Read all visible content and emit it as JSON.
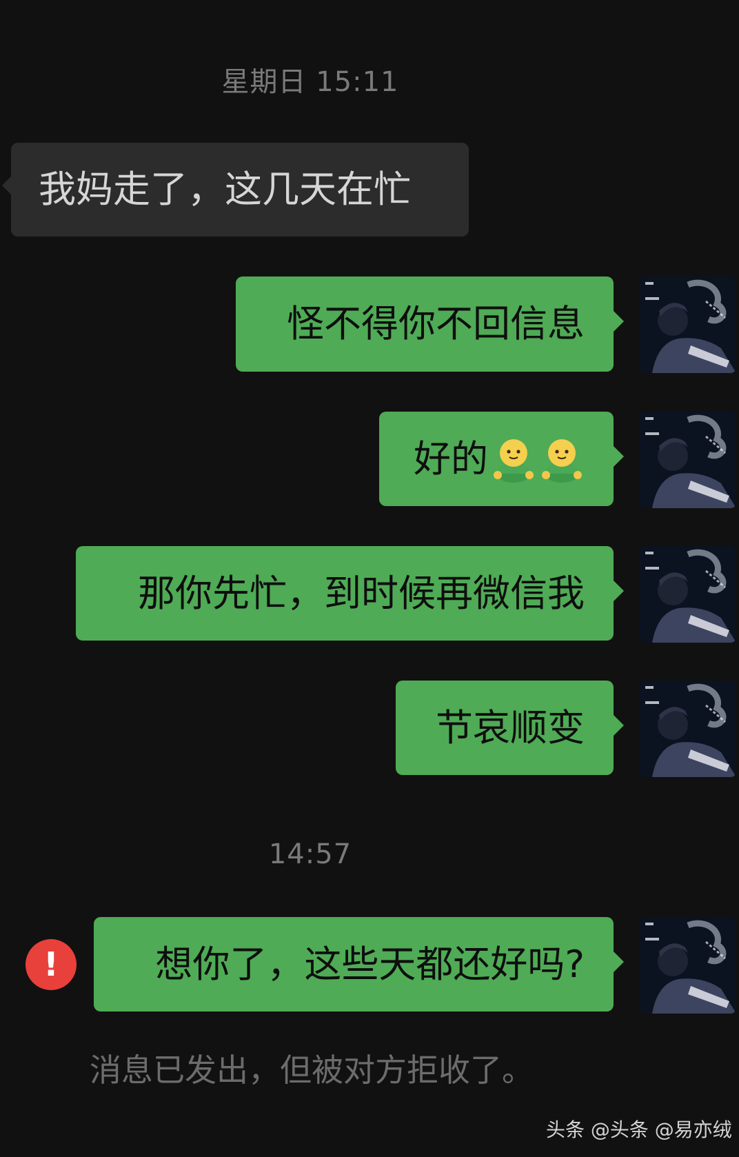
{
  "chat": {
    "timestamp_1": "星期日 15:11",
    "timestamp_2": "14:57",
    "messages": [
      {
        "direction": "incoming",
        "text": "我妈走了，这几天在忙"
      },
      {
        "direction": "outgoing",
        "text": "怪不得你不回信息"
      },
      {
        "direction": "outgoing",
        "text": "好的",
        "emojis": [
          "smiling-figure-emoji",
          "smiling-figure-emoji"
        ]
      },
      {
        "direction": "outgoing",
        "text": "那你先忙，到时候再微信我"
      },
      {
        "direction": "outgoing",
        "text": "节哀顺变"
      },
      {
        "direction": "outgoing",
        "text": "想你了，这些天都还好吗?",
        "status": "failed"
      }
    ],
    "error_icon_symbol": "!",
    "system_note": "消息已发出，但被对方拒收了。"
  },
  "watermark": "头条 @头条 @易亦绒",
  "colors": {
    "background": "#111111",
    "incoming_bubble": "#2c2c2c",
    "outgoing_bubble": "#4fab55",
    "error_icon": "#e8403a"
  }
}
